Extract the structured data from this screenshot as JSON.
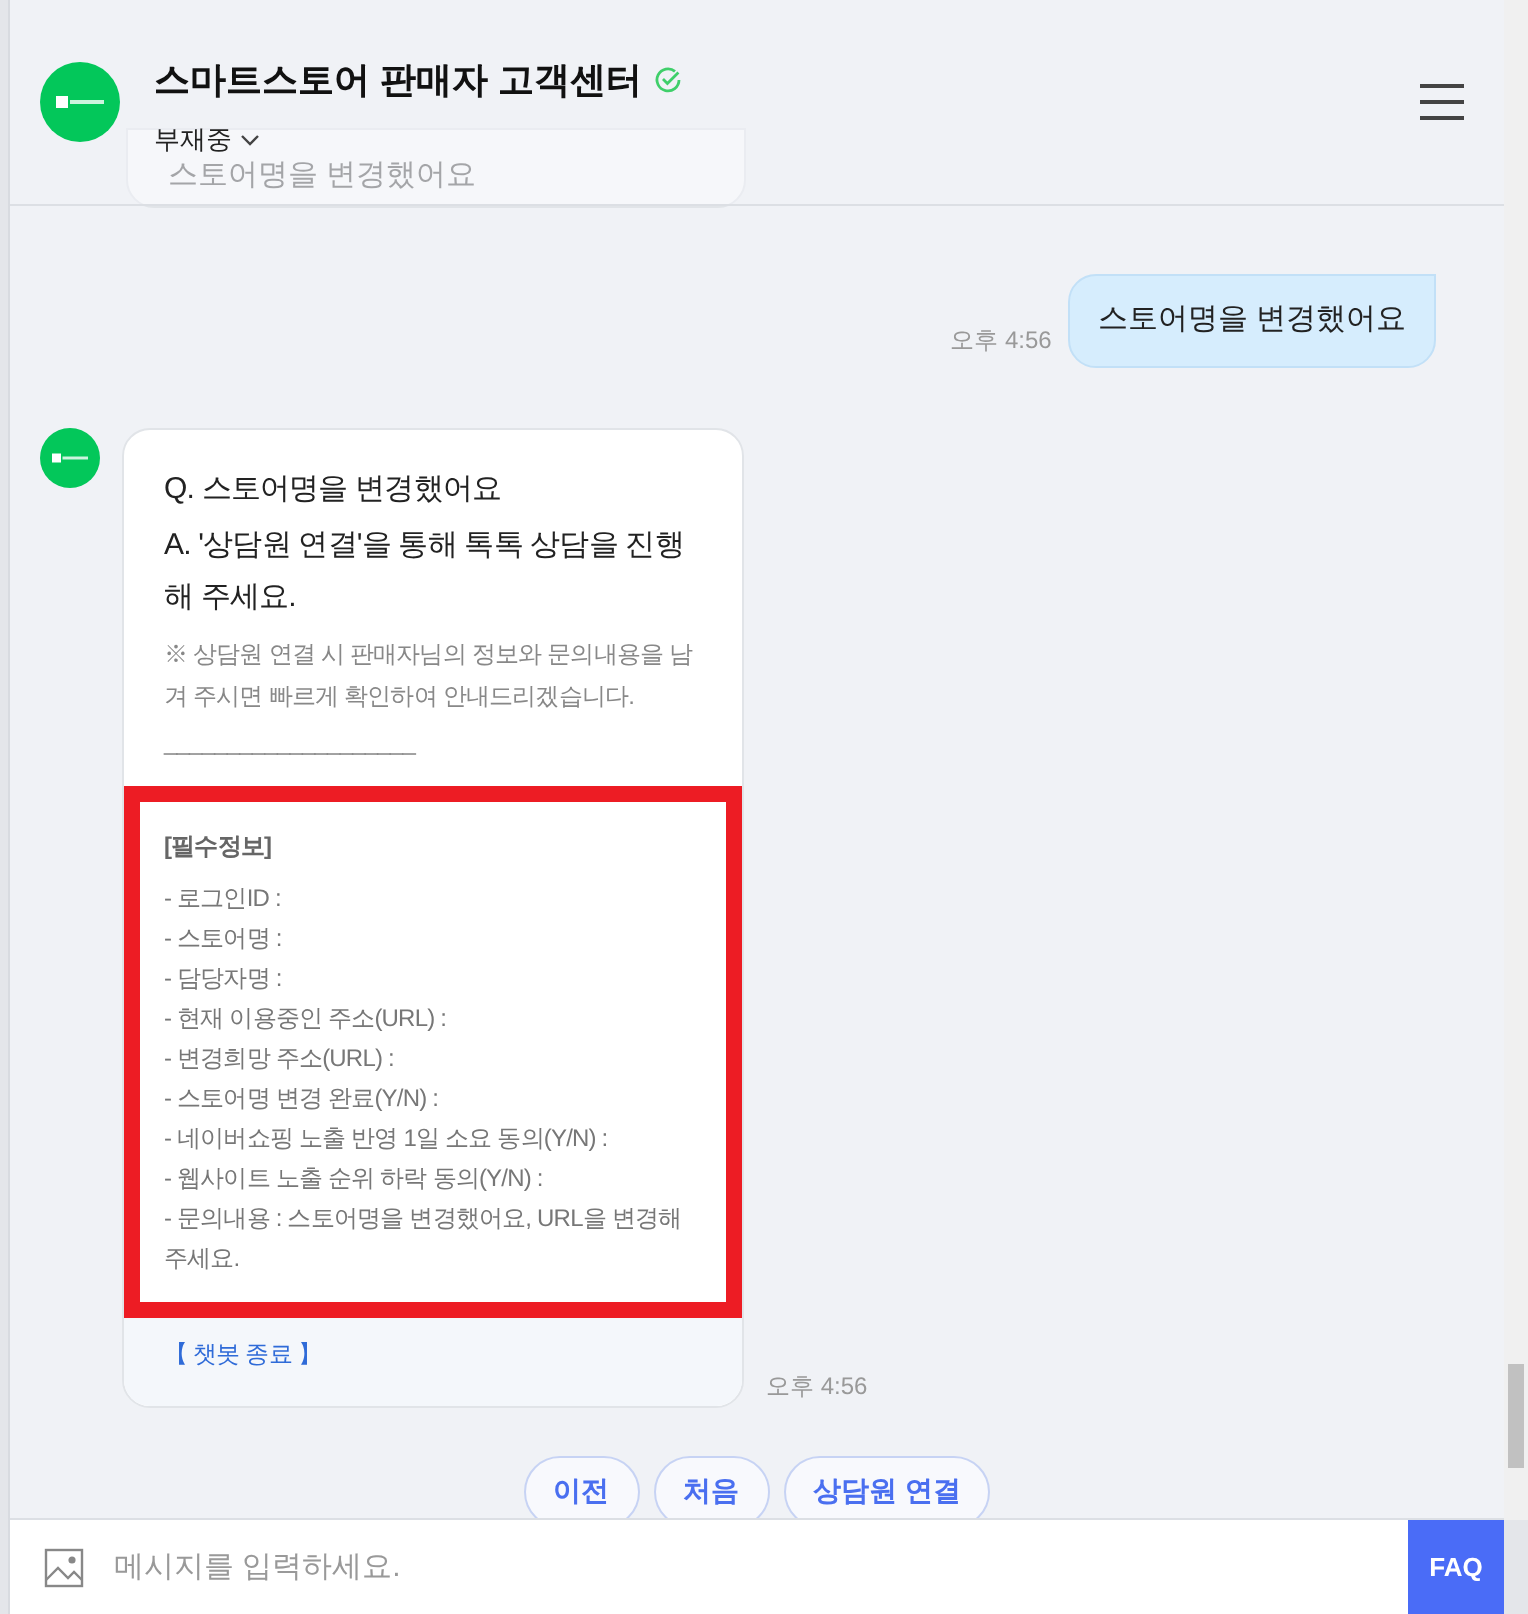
{
  "header": {
    "title": "스마트스토어 판매자 고객센터",
    "verified": true,
    "status": "부재중"
  },
  "earlier_message": {
    "text": "스토어명을 변경했어요"
  },
  "user_message": {
    "time": "오후 4:56",
    "text": "스토어명을 변경했어요"
  },
  "bot_message": {
    "question": "Q. 스토어명을 변경했어요",
    "answer": "A. '상담원 연결'을 통해 톡톡 상담을 진행해 주세요.",
    "note": "※ 상담원 연결 시 판매자님의 정보와 문의내용을 남겨 주시면 빠르게 확인하여 안내드리겠습니다.",
    "divider": "____________________",
    "required_title": "[필수정보]",
    "required_items": [
      "- 로그인ID :",
      "- 스토어명 :",
      "- 담당자명 :",
      "- 현재 이용중인 주소(URL) :",
      "- 변경희망 주소(URL) :",
      "- 스토어명 변경 완료(Y/N) :",
      "- 네이버쇼핑 노출 반영 1일 소요 동의(Y/N) :",
      "- 웹사이트 노출 순위 하락 동의(Y/N) :",
      "- 문의내용 : 스토어명을 변경했어요, URL을 변경해 주세요."
    ],
    "end_link": "【 챗봇 종료 】",
    "time": "오후 4:56"
  },
  "quick_replies": [
    "이전",
    "처음",
    "상담원 연결"
  ],
  "composer": {
    "placeholder": "메시지를 입력하세요.",
    "button": "FAQ"
  }
}
